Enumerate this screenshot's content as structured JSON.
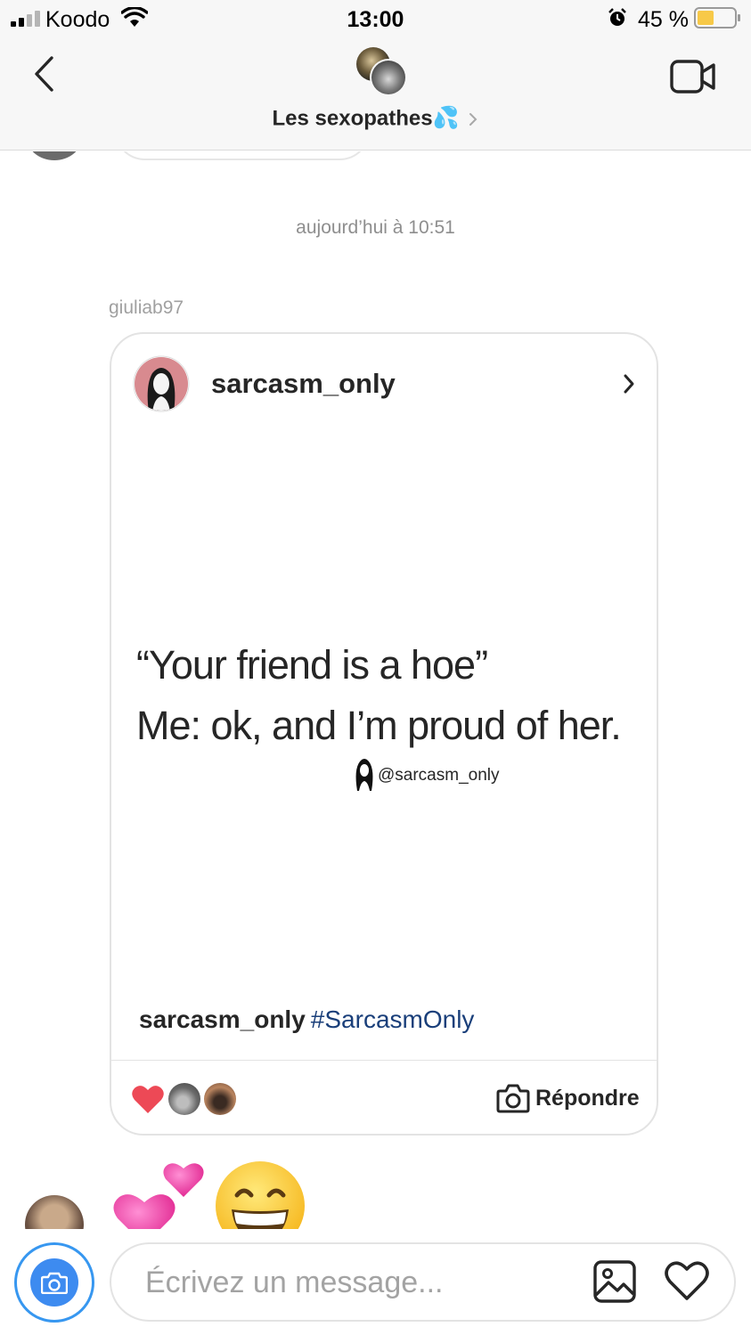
{
  "status_bar": {
    "carrier": "Koodo",
    "time": "13:00",
    "battery_percent_text": "45 %",
    "battery_level": 0.45,
    "battery_color": "#f7c948",
    "icons": [
      "signal-icon",
      "wifi-icon",
      "alarm-icon",
      "battery-icon"
    ]
  },
  "header": {
    "title": "Les sexopathes",
    "title_emoji": "💦",
    "icons": [
      "back-chevron-icon",
      "group-avatar",
      "chevron-right-icon",
      "video-call-icon"
    ]
  },
  "chat": {
    "timestamp": "aujourd’hui à 10:51",
    "sender": "giuliab97",
    "shared_post": {
      "username": "sarcasm_only",
      "quote_line_1": "“Your friend is a hoe”",
      "quote_line_2": "Me: ok, and I’m proud of her.",
      "watermark": "@sarcasm_only",
      "caption_user": "sarcasm_only",
      "caption_hashtag": "#SarcasmOnly",
      "hashtag_color": "#1a3f7a",
      "reaction_color": "#ed4956",
      "reply_label": "Répondre"
    },
    "emoji_message": "💕😁"
  },
  "composer": {
    "placeholder": "Écrivez un message...",
    "accent_color": "#3797f0",
    "icons": [
      "camera-icon",
      "gallery-icon",
      "heart-like-icon"
    ]
  }
}
